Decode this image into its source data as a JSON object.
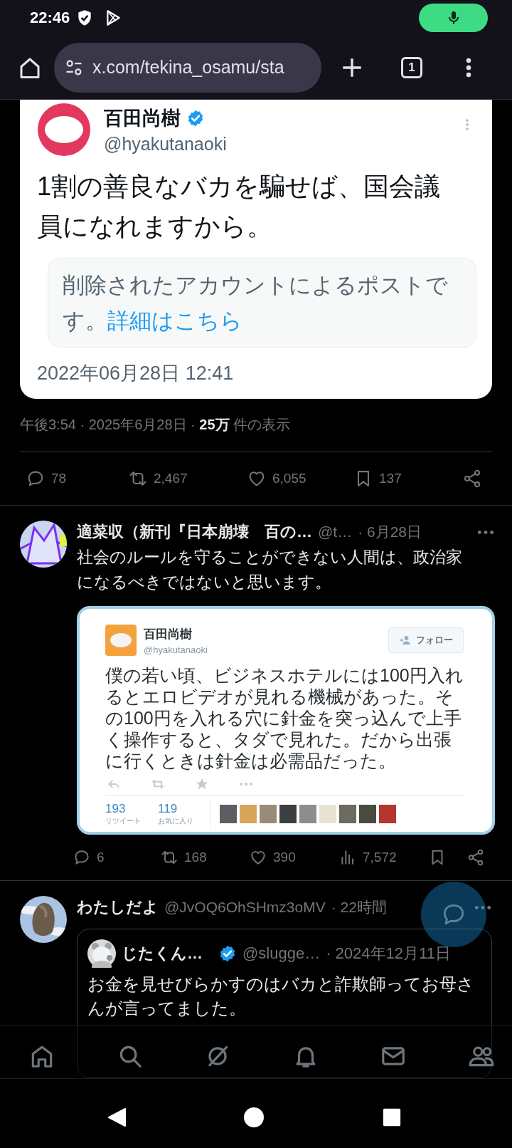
{
  "status_bar": {
    "time": "22:46"
  },
  "browser": {
    "url": "x.com/tekina_osamu/sta",
    "tab_count": "1"
  },
  "main_post": {
    "image": {
      "name": "百田尚樹",
      "verified": true,
      "handle": "@hyakutanaoki",
      "text_lines": [
        "1割の善良なバカを騙せば、国会議",
        "員になれますから。"
      ],
      "notice": "削除されたアカウントによるポストです。",
      "notice_link": "詳細はこちら",
      "date": "2022年06月28日 12:41"
    },
    "meta": "午後3:54 · 2025年6月28日 · **25万** 件の表示",
    "actions": [
      {
        "kind": "reply",
        "count": "78"
      },
      {
        "kind": "repost",
        "count": "2,467"
      },
      {
        "kind": "like",
        "count": "6,055"
      },
      {
        "kind": "bookmark",
        "count": "137"
      },
      {
        "kind": "share"
      }
    ]
  },
  "replies": [
    {
      "name": "適菜収（新刊『日本崩壊　百の…",
      "handle": "@t…",
      "time": "· 6月28日",
      "text": "社会のルールを守ることができない人間は、政治家になるべきではないと思います。",
      "screenshot": {
        "name": "百田尚樹",
        "handle": "@hyakutanaoki",
        "follow": "フォロー",
        "text_lines": [
          "僕の若い頃、ビジネスホテルには100円入れ",
          "るとエロビデオが見れる機械があった。そ",
          "の100円を入れる穴に針金を突っ込んで上手",
          "く操作すると、タダで見れた。だから出張",
          "に行くときは針金は必需品だった。"
        ],
        "stats": [
          {
            "value": "193",
            "label": "リツイート"
          },
          {
            "value": "119",
            "label": "お気に入り"
          }
        ]
      },
      "actions": [
        {
          "kind": "reply",
          "count": "6"
        },
        {
          "kind": "repost",
          "count": "168"
        },
        {
          "kind": "like",
          "count": "390"
        },
        {
          "kind": "views",
          "count": "7,572"
        },
        {
          "kind": "bookmark"
        },
        {
          "kind": "share"
        }
      ]
    },
    {
      "name": "わたしだよ",
      "handle": "@JvOQ6OhSHmz3oMV",
      "time": "· 22時間",
      "quote": {
        "name": "じたくん…",
        "verified": true,
        "handle": "@slugge…",
        "time": "· 2024年12月11日",
        "text": "お金を見せびらかすのはバカと詐欺師ってお母さんが言ってました。"
      }
    }
  ]
}
